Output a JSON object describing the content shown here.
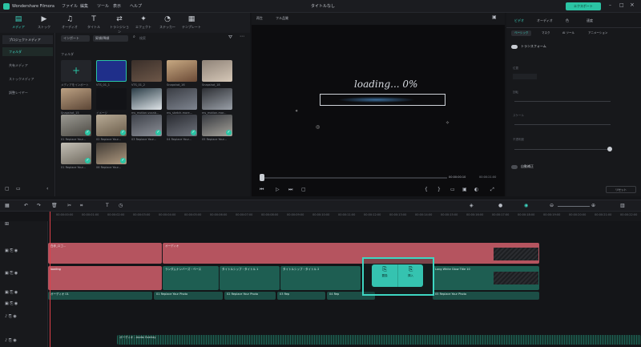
{
  "titlebar": {
    "app_name": "Wondershare Filmora",
    "menu": [
      "ファイル",
      "編集",
      "ツール",
      "表示",
      "ヘルプ"
    ],
    "doc_title": "タイトルなし",
    "badge": "エクスポート"
  },
  "toolbar": [
    {
      "label": "メディア",
      "icon": "media-icon"
    },
    {
      "label": "ストック",
      "icon": "stock-icon"
    },
    {
      "label": "オーディオ",
      "icon": "audio-icon"
    },
    {
      "label": "タイトル",
      "icon": "title-icon"
    },
    {
      "label": "トランジション",
      "icon": "transition-icon"
    },
    {
      "label": "エフェクト",
      "icon": "effect-icon"
    },
    {
      "label": "ステッカー",
      "icon": "sticker-icon"
    },
    {
      "label": "テンプレート",
      "icon": "template-icon"
    }
  ],
  "sidebar": {
    "header": "プロジェクトメディア",
    "items": [
      "フォルダ",
      "共有メディア",
      "ストックメディア",
      "調整レイヤー"
    ]
  },
  "media": {
    "import_label": "インポート",
    "filter_label": "昇順/降順",
    "search_placeholder": "検索",
    "folder_label": "フォルダ",
    "items": [
      "メディアをインポート",
      "VTS_01_1",
      "VTS_01_2",
      "Snapshot_16",
      "Snapshot_18",
      "Snapshot_15",
      "イメージ",
      "ms_motion-vocab...",
      "ms_sketch-more...",
      "ms_motion-mar...",
      "01 Replace Your...",
      "02 Replace Your...",
      "03 Replace Your...",
      "04 Replace Your...",
      "05 Replace Your...",
      "01 Replace Your...",
      "06 Replace Your..."
    ]
  },
  "preview": {
    "tab1": "再生",
    "tab2": "フル品質",
    "loading_text": "loading... 0%",
    "time_current": "00:00:00:10",
    "time_total": "00:00:21:00"
  },
  "props": {
    "tabs": [
      "ビデオ",
      "オーディオ",
      "色",
      "速度"
    ],
    "subtabs": [
      "ベーシック",
      "マスク",
      "AI ツール",
      "アニメーション"
    ],
    "sections": [
      "トランスフォーム",
      "位置",
      "回転",
      "スケール",
      "不透明度",
      "自動補正"
    ],
    "reset": "リセット"
  },
  "ruler": [
    "00:00:00:00",
    "00:00:01:00",
    "00:00:02:00",
    "00:00:03:00",
    "00:00:04:00",
    "00:00:05:00",
    "00:00:06:00",
    "00:00:07:00",
    "00:00:08:00",
    "00:00:09:00",
    "00:00:10:00",
    "00:00:11:00",
    "00:00:12:00",
    "00:00:13:00",
    "00:00:14:00",
    "00:00:15:00",
    "00:00:16:00",
    "00:00:17:00",
    "00:00:18:00",
    "00:00:19:00",
    "00:00:20:00",
    "00:00:21:00",
    "00:00:22:00"
  ],
  "clips": {
    "red1": "白枠_ロゴ...",
    "red2": "オーディオ",
    "g1": "ランダムナンバーズ・ベース",
    "g2": "タイトルシップ・タイトル 1",
    "g3": "タイトルシップ・タイトル 2",
    "g4": "Long White Glow Title 10",
    "loading": "loading",
    "bottom": "オーディオ 01",
    "rep1": "01 Replace Your Photo",
    "rep2": "02 Replace Your Photo",
    "rep3": "03 Rep",
    "rep4": "04 Rep",
    "rep5": "05 Replace Your Photo",
    "wave": "オーディオ - Audio Overlay"
  },
  "popup": {
    "btn1": "置換",
    "btn2": "挿入"
  }
}
